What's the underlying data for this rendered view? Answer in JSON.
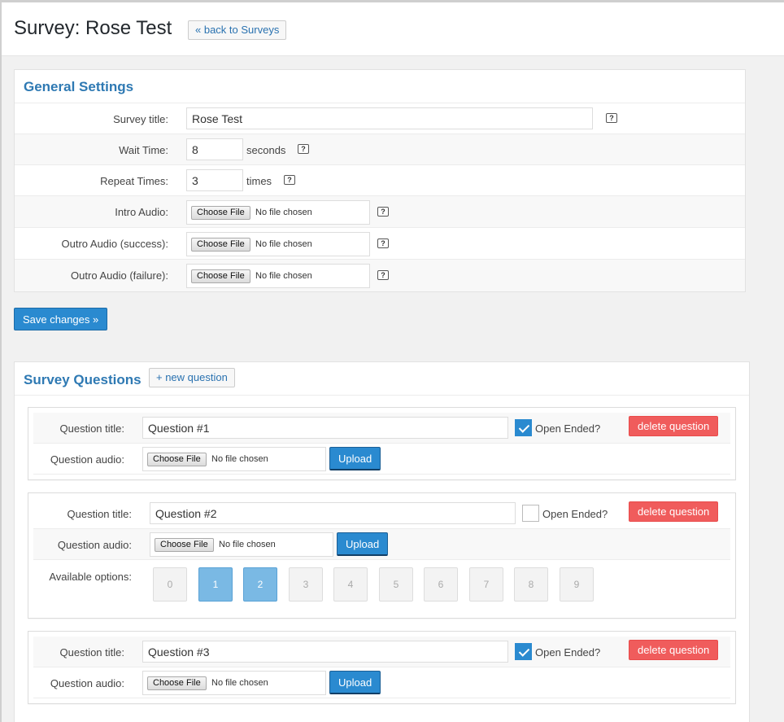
{
  "header": {
    "title": "Survey: Rose Test",
    "back_label": "« back to Surveys"
  },
  "general": {
    "title": "General Settings",
    "survey_title_label": "Survey title:",
    "survey_title_value": "Rose Test",
    "wait_time_label": "Wait Time:",
    "wait_time_value": "8",
    "wait_time_unit": "seconds",
    "repeat_label": "Repeat Times:",
    "repeat_value": "3",
    "repeat_unit": "times",
    "intro_label": "Intro Audio:",
    "outro_success_label": "Outro Audio (success):",
    "outro_failure_label": "Outro Audio (failure):",
    "choose_file": "Choose File",
    "no_file": "No file chosen",
    "help_glyph": "?"
  },
  "save_label": "Save changes »",
  "questions": {
    "title": "Survey Questions",
    "new_label": "+ new question",
    "title_label": "Question title:",
    "audio_label": "Question audio:",
    "options_label": "Available options:",
    "open_ended_label": "Open Ended?",
    "delete_label": "delete question",
    "upload_label": "Upload",
    "items": [
      {
        "title": "Question #1",
        "open_ended": true
      },
      {
        "title": "Question #2",
        "open_ended": false,
        "options": [
          "0",
          "1",
          "2",
          "3",
          "4",
          "5",
          "6",
          "7",
          "8",
          "9"
        ],
        "selected": [
          "1",
          "2"
        ]
      },
      {
        "title": "Question #3",
        "open_ended": true
      }
    ]
  },
  "colors": {
    "accent": "#2a8ad0",
    "title_blue": "#2e79b3",
    "danger": "#f05c5c",
    "selected_option": "#7ab9e4"
  }
}
